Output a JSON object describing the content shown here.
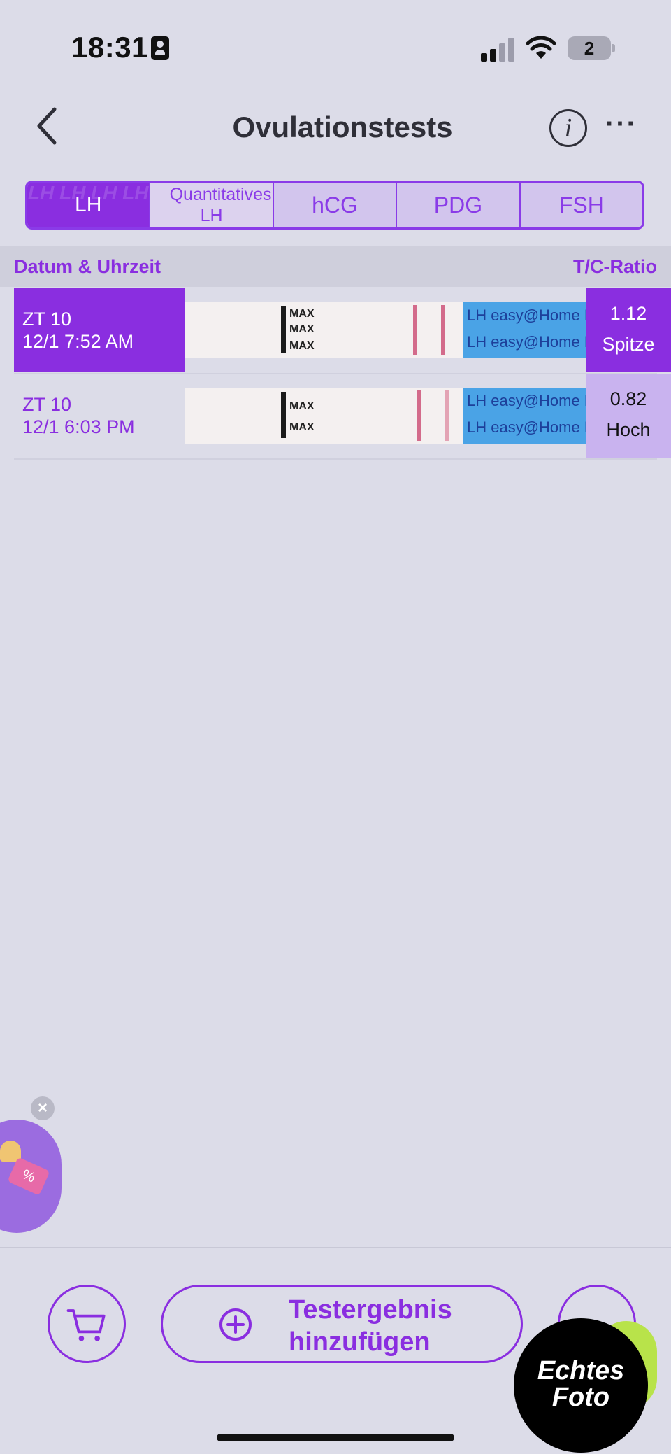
{
  "status_bar": {
    "time": "18:31",
    "battery": "2"
  },
  "header": {
    "title": "Ovulationstests"
  },
  "tabs": [
    {
      "label": "LH",
      "watermark": "LH LH LH LH"
    },
    {
      "label": "Quantitatives LH"
    },
    {
      "label": "hCG"
    },
    {
      "label": "PDG"
    },
    {
      "label": "FSH"
    }
  ],
  "table": {
    "col_left": "Datum & Uhrzeit",
    "col_right": "T/C-Ratio",
    "rows": [
      {
        "cycle": "ZT 10",
        "datetime": "12/1 7:52 AM",
        "ratio": "1.12",
        "level": "Spitze",
        "strip_text": "LH  easy@Home  LH  easy@Home  LH"
      },
      {
        "cycle": "ZT 10",
        "datetime": "12/1 6:03 PM",
        "ratio": "0.82",
        "level": "Hoch",
        "strip_text": "LH  easy@Home  LH  easy@Home  LH"
      }
    ],
    "strip_max_label": "MAX"
  },
  "promo": {
    "label": "%"
  },
  "bottom": {
    "add_label": "Testergebnis hinzufügen"
  },
  "badge": {
    "line1": "Echtes",
    "line2": "Foto"
  },
  "colors": {
    "accent": "#8a2ee0",
    "background": "#dcdce8"
  }
}
